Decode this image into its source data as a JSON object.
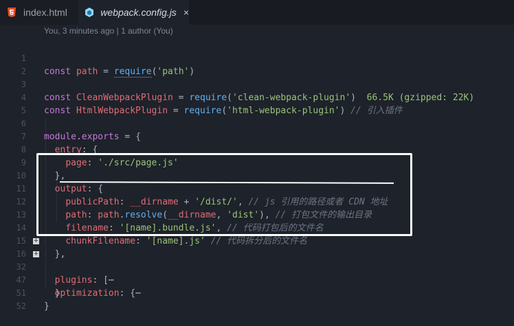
{
  "tabs": [
    {
      "label": "index.html",
      "icon": "html5-icon"
    },
    {
      "label": "webpack.config.js",
      "icon": "webpack-icon",
      "close": "×"
    }
  ],
  "blame": "You, 3 minutes ago | 1 author (You)",
  "lines": [
    {
      "n": "1"
    },
    {
      "n": "2"
    },
    {
      "n": "3"
    },
    {
      "n": "4"
    },
    {
      "n": "5"
    },
    {
      "n": "6"
    },
    {
      "n": "7"
    },
    {
      "n": "8"
    },
    {
      "n": "9"
    },
    {
      "n": "10"
    },
    {
      "n": "11"
    },
    {
      "n": "12"
    },
    {
      "n": "13"
    },
    {
      "n": "14"
    },
    {
      "n": "15"
    },
    {
      "n": "16"
    },
    {
      "n": "32"
    },
    {
      "n": "47"
    },
    {
      "n": "51"
    },
    {
      "n": "52"
    }
  ],
  "code": {
    "l1": [
      "const ",
      "path",
      " = ",
      "require",
      "(",
      "'path'",
      ")"
    ],
    "l3": [
      "const ",
      "CleanWebpackPlugin",
      " = ",
      "require",
      "(",
      "'clean-webpack-plugin'",
      ")",
      "66.5K (gzipped: 22K)"
    ],
    "l4": [
      "const ",
      "HtmlWebpackPlugin",
      " = ",
      "require",
      "(",
      "'html-webpack-plugin'",
      ")",
      " // 引入插件"
    ],
    "l6": [
      "module",
      ".",
      "exports",
      " = {"
    ],
    "l7": [
      "entry",
      ": {"
    ],
    "l8": [
      "page",
      ": ",
      "'./src/page.js'"
    ],
    "l9": [
      "},"
    ],
    "l10": [
      "output",
      ": {"
    ],
    "l11": [
      "publicPath",
      ": ",
      "__dirname",
      " + ",
      "'/dist/'",
      ", ",
      "// js 引用的路径或者 CDN 地址"
    ],
    "l12": [
      "path",
      ": ",
      "path",
      ".",
      "resolve",
      "(",
      "__dirname",
      ", ",
      "'dist'",
      "), ",
      "// 打包文件的输出目录"
    ],
    "l13": [
      "filename",
      ": ",
      "'[name].bundle.js'",
      ", ",
      "// 代码打包后的文件名"
    ],
    "l14": [
      "chunkFilename",
      ": ",
      "'[name].js'",
      " ",
      "// 代码拆分后的文件名"
    ],
    "l15": [
      "},"
    ],
    "l16": [
      "plugins",
      ": [",
      "⋯"
    ],
    "l32": [
      "optimization",
      ": {",
      "⋯"
    ],
    "l47": [
      "}"
    ],
    "l51": [
      "}"
    ]
  },
  "fold_symbol": "+"
}
